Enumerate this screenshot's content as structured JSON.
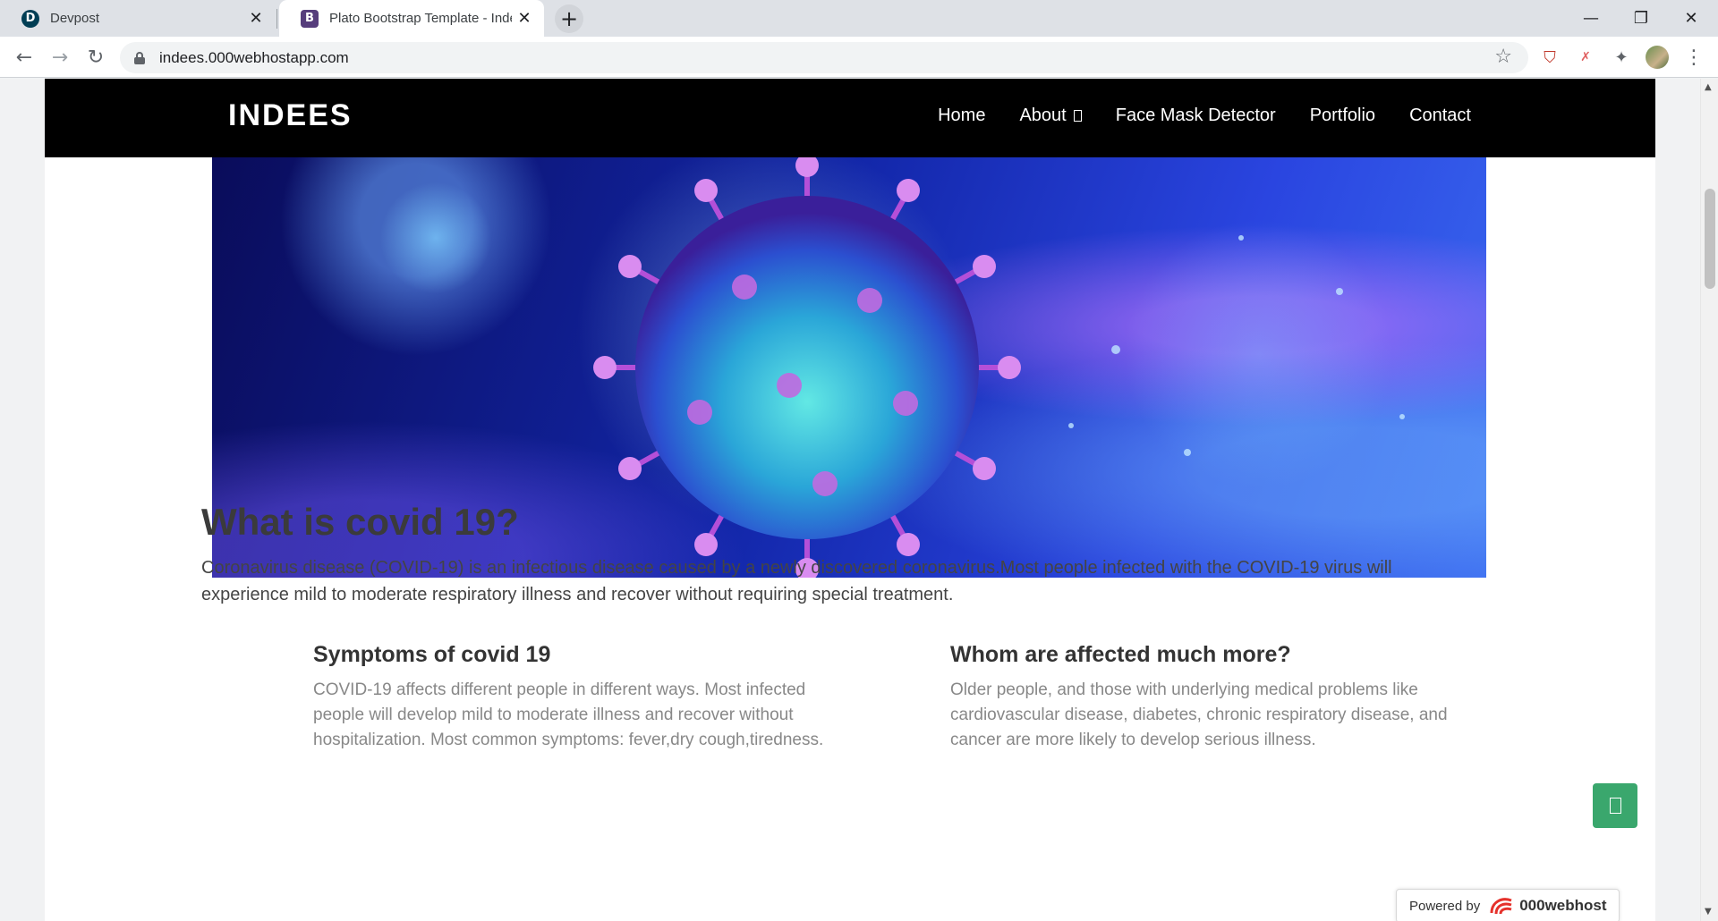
{
  "browser": {
    "tabs": [
      {
        "title": "Devpost",
        "favicon_letter": "D",
        "active": false
      },
      {
        "title": "Plato Bootstrap Template - Index",
        "favicon_letter": "B",
        "active": true
      }
    ],
    "new_tab_symbol": "+",
    "close_symbol": "✕",
    "window_controls": {
      "minimize": "—",
      "maximize": "❐",
      "close": "✕"
    },
    "nav": {
      "back": "←",
      "forward": "→",
      "reload": "↻"
    },
    "url": "indees.000webhostapp.com",
    "star": "☆",
    "extensions": {
      "pocket": "⛉",
      "other": "✗",
      "puzzle": "✦",
      "menu": "⋮"
    }
  },
  "site": {
    "brand": "INDEES",
    "menu": [
      {
        "label": "Home"
      },
      {
        "label": "About"
      },
      {
        "label": "Face Mask Detector"
      },
      {
        "label": "Portfolio"
      },
      {
        "label": "Contact"
      }
    ]
  },
  "hero": {
    "image": "coronavirus-illustration"
  },
  "article": {
    "title": "What is covid 19?",
    "lead": "Coronavirus disease (COVID-19) is an infectious disease caused by a newly discovered coronavirus.Most people infected with the COVID-19 virus will experience mild to moderate respiratory illness and recover without requiring special treatment.",
    "columns": [
      {
        "title": "Symptoms of covid 19",
        "text": "COVID-19 affects different people in different ways. Most infected people will develop mild to moderate illness and recover without hospitalization. Most common symptoms: fever,dry cough,tiredness."
      },
      {
        "title": "Whom are affected much more?",
        "text": "Older people, and those with underlying medical problems like cardiovascular disease, diabetes, chronic respiratory disease, and cancer are more likely to develop serious illness."
      }
    ]
  },
  "footer_badge": {
    "label": "Powered by",
    "brand": "000webhost"
  },
  "colors": {
    "navbar": "#000000",
    "fab": "#3aa76d",
    "heading": "#3b3b3b",
    "muted": "#888888"
  }
}
